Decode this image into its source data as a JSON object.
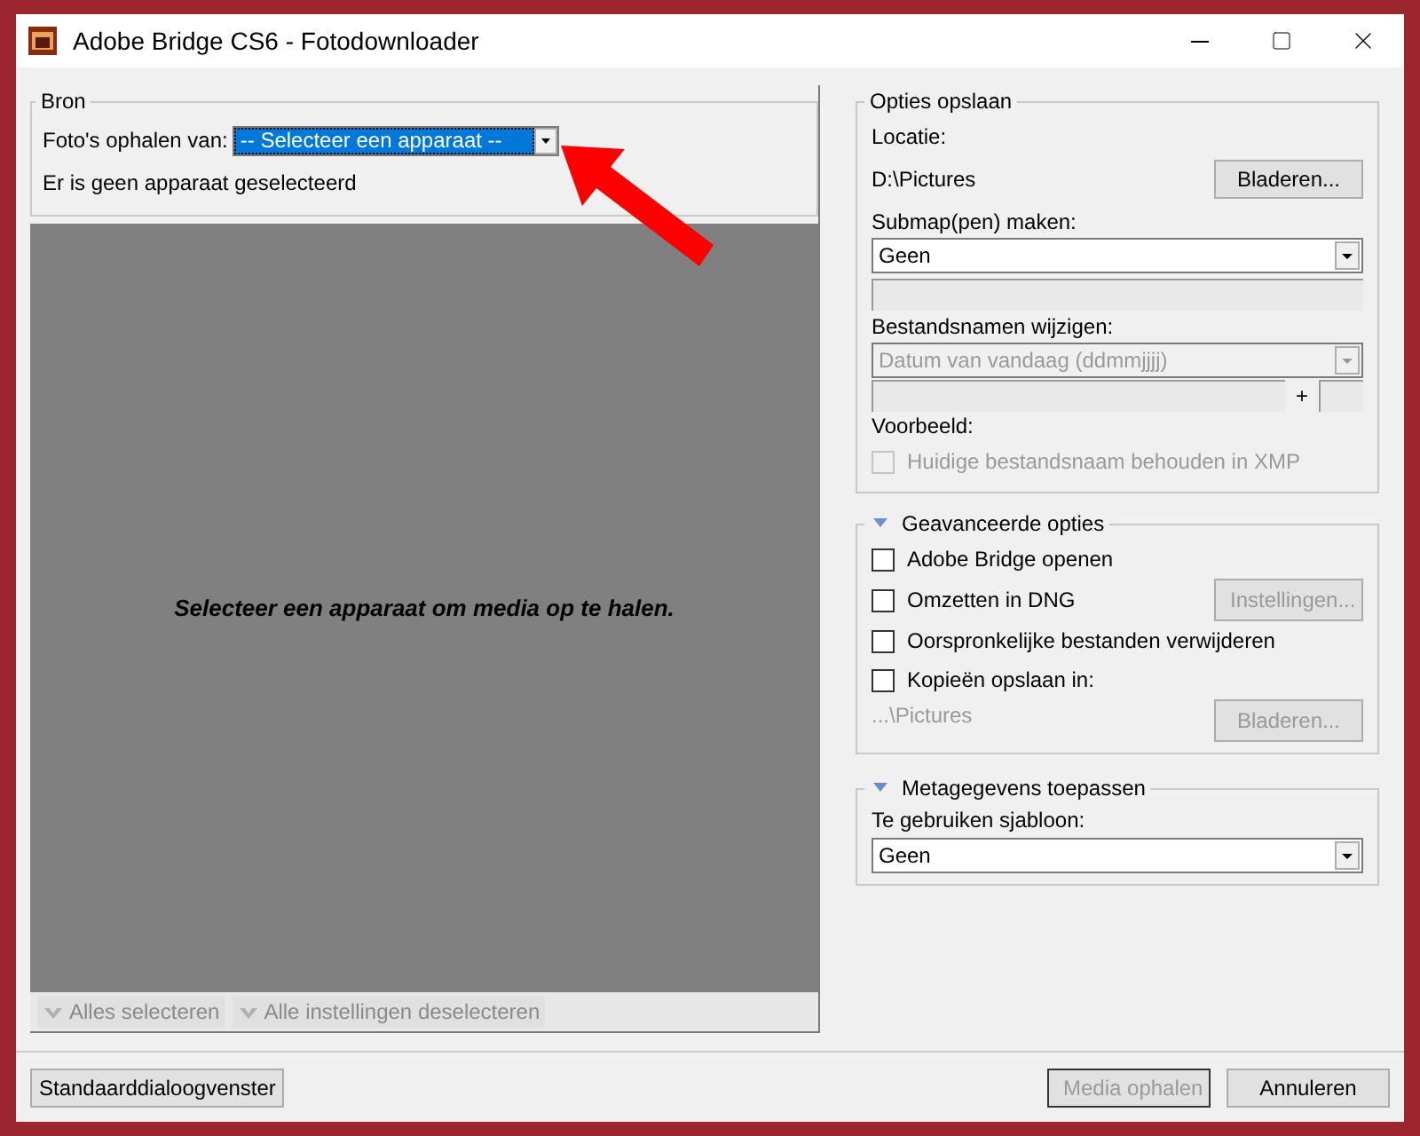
{
  "window": {
    "title": "Adobe Bridge CS6 - Fotodownloader"
  },
  "source": {
    "title": "Bron",
    "label": "Foto's ophalen van:",
    "dropdown": {
      "value": "-- Selecteer een apparaat --",
      "selected": true
    },
    "status": "Er is geen apparaat geselecteerd",
    "message": "Selecteer een apparaat om media op te halen.",
    "buttons": [
      {
        "label": "Alles selecteren",
        "disabled": true
      },
      {
        "label": "Alle instellingen deselecteren",
        "disabled": true
      }
    ]
  },
  "save_options": {
    "title": "Opties opslaan",
    "location_label": "Locatie:",
    "location": "D:\\Pictures",
    "browse": {
      "label": "Bladeren...",
      "disabled": false
    },
    "subfolder_label": "Submap(pen) maken:",
    "subfolder": {
      "value": "Geen",
      "disabled": false
    },
    "rename_label": "Bestandsnamen wijzigen:",
    "rename": {
      "value": "Datum van vandaag (ddmmjjjj)",
      "disabled": true
    },
    "plus": "+",
    "preview_label": "Voorbeeld:",
    "keep_name": {
      "label": "Huidige bestandsnaam behouden in XMP",
      "checked": false,
      "disabled": true
    }
  },
  "advanced": {
    "title": "Geavanceerde opties",
    "expanded": true,
    "options": [
      {
        "label": "Adobe Bridge openen",
        "checked": false
      },
      {
        "label": "Omzetten in DNG",
        "checked": false
      },
      {
        "label": "Oorspronkelijke bestanden verwijderen",
        "checked": false
      },
      {
        "label": "Kopieën opslaan in:",
        "checked": false
      }
    ],
    "settings_button": {
      "label": "Instellingen...",
      "disabled": true
    },
    "copy_path": "...\\Pictures",
    "browse": {
      "label": "Bladeren...",
      "disabled": true
    }
  },
  "metadata": {
    "title": "Metagegevens toepassen",
    "expanded": true,
    "template_label": "Te gebruiken sjabloon:",
    "template": {
      "value": "Geen",
      "disabled": false
    }
  },
  "footer": {
    "left_button": {
      "label": "Standaarddialoogvenster",
      "disabled": false
    },
    "right_buttons": [
      {
        "label": "Media ophalen",
        "disabled": true,
        "default": true
      },
      {
        "label": "Annuleren",
        "disabled": false,
        "default": false
      }
    ]
  }
}
